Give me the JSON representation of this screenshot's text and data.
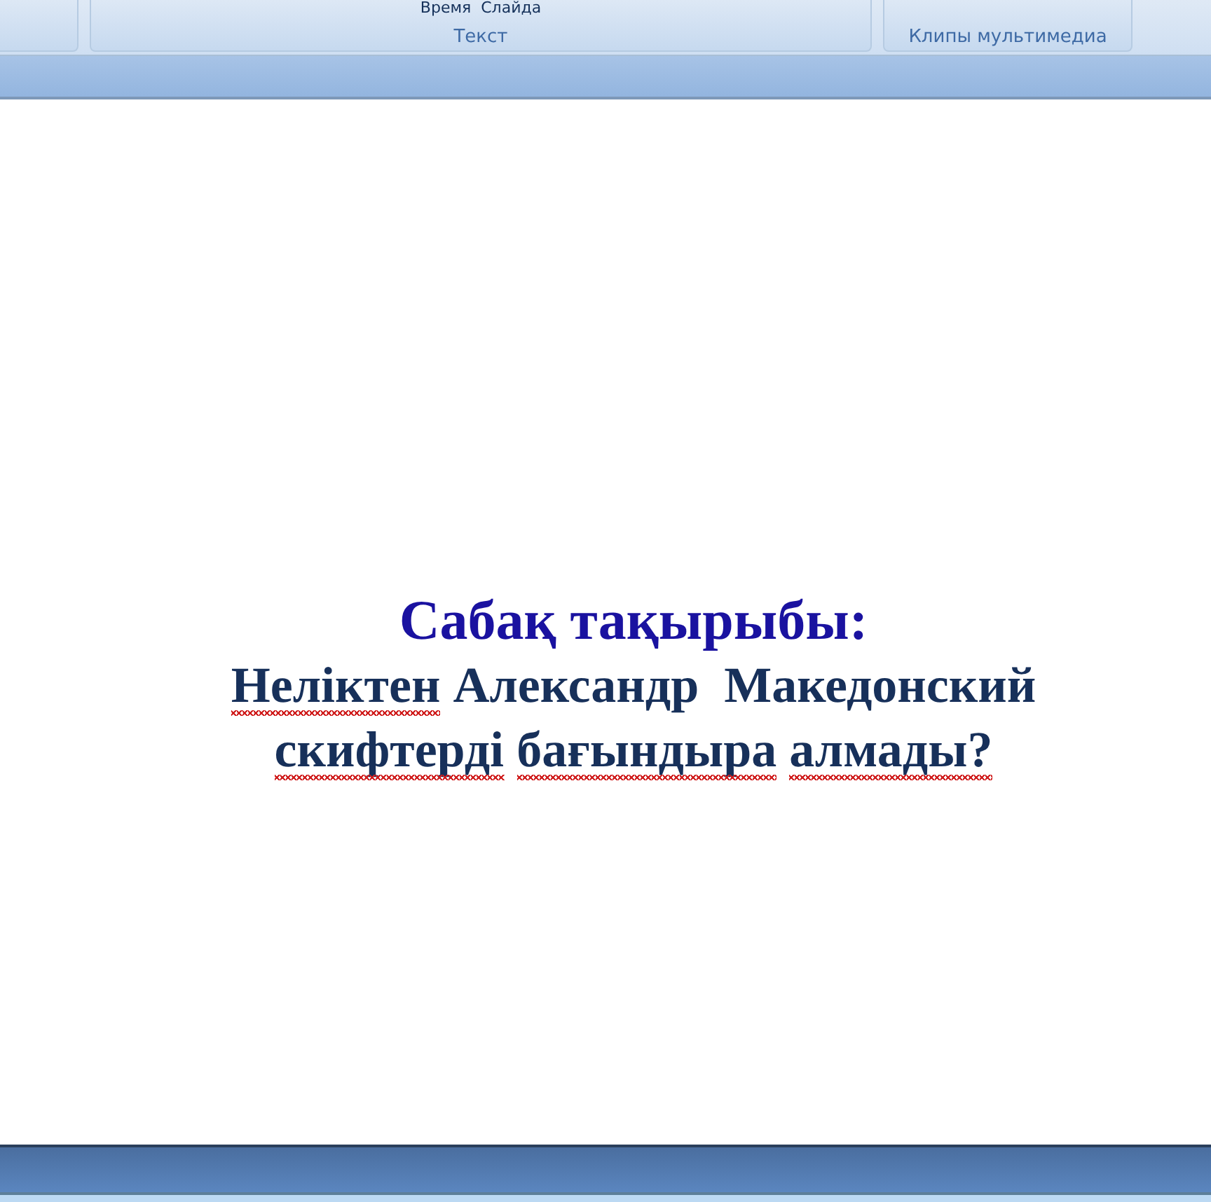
{
  "ribbon": {
    "groups": [
      {
        "label": "Текст",
        "commands": [
          "Время  Слайда"
        ]
      },
      {
        "label": "Клипы мультимедиа"
      }
    ]
  },
  "slide": {
    "title": "Сабақ тақырыбы:",
    "lines": [
      [
        {
          "text": "Неліктен",
          "misspelled": true
        },
        {
          "text": "Александр",
          "misspelled": false
        },
        {
          "text": " Македонский",
          "misspelled": false
        }
      ],
      [
        {
          "text": "скифтерді",
          "misspelled": true
        },
        {
          "text": "бағындыра",
          "misspelled": true
        },
        {
          "text": "алмады?",
          "misspelled": true
        }
      ]
    ]
  }
}
